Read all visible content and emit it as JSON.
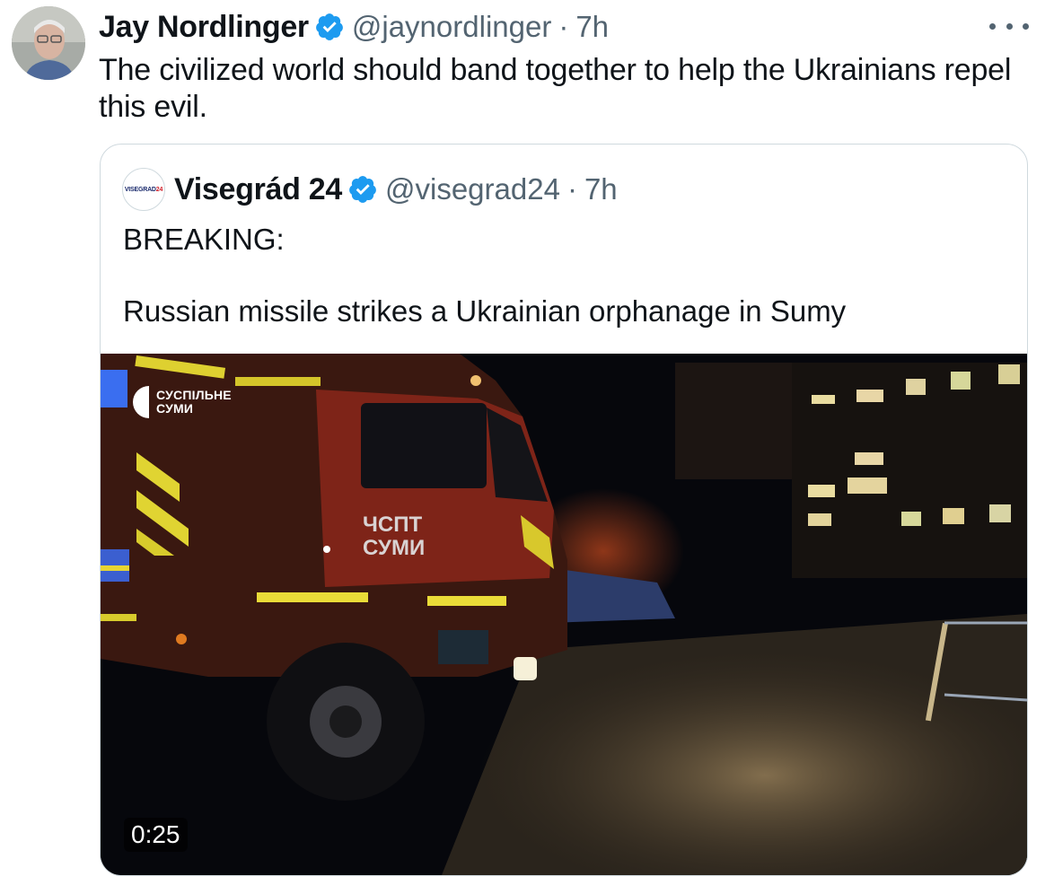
{
  "tweet": {
    "display_name": "Jay Nordlinger",
    "handle": "@jaynordlinger",
    "separator": "·",
    "time": "7h",
    "text": "The civilized world should band together to help the Ukrainians repel this evil.",
    "more_icon": "more-horizontal-icon",
    "verified_icon": "verified-badge-icon"
  },
  "quoted_tweet": {
    "display_name": "Visegrád 24",
    "handle": "@visegrad24",
    "separator": "·",
    "time": "7h",
    "avatar_logo_text": "VISEGRAD",
    "avatar_logo_number": "24",
    "text_line1": "BREAKING:",
    "text_line2": "Russian missile strikes a Ukrainian orphanage in Sumy",
    "video": {
      "watermark_line1": "СУСПІЛЬНЕ",
      "watermark_line2": "СУМИ",
      "truck_label_line1": "ЧСПТ",
      "truck_label_line2": "СУМИ",
      "duration": "0:25"
    }
  },
  "colors": {
    "text_primary": "#0f1419",
    "text_secondary": "#536471",
    "verified_blue": "#1d9bf0",
    "border": "#cfd9de"
  }
}
